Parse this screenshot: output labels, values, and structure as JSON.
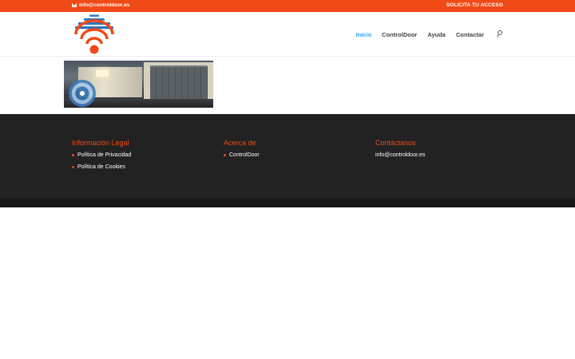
{
  "topbar": {
    "email": "info@controldoor.es",
    "cta_label": "SOLICITA TU ACCESO"
  },
  "header": {
    "nav": [
      {
        "label": "Inicio",
        "active": true
      },
      {
        "label": "ControlDoor"
      },
      {
        "label": "Ayuda"
      },
      {
        "label": "Contactar"
      }
    ]
  },
  "colors": {
    "accent": "#f04a16",
    "nav_active": "#2ea3f2",
    "footer_bg": "#222222",
    "logo_blue": "#2a73c4"
  },
  "footer": {
    "legal": {
      "title": "Información Legal",
      "items": [
        "Política de Privacidad",
        "Política de Cookies"
      ]
    },
    "about": {
      "title": "Acerca de",
      "items": [
        "ControlDoor"
      ]
    },
    "contact": {
      "title": "Contáctanos",
      "email": "info@controldoor.es"
    }
  }
}
